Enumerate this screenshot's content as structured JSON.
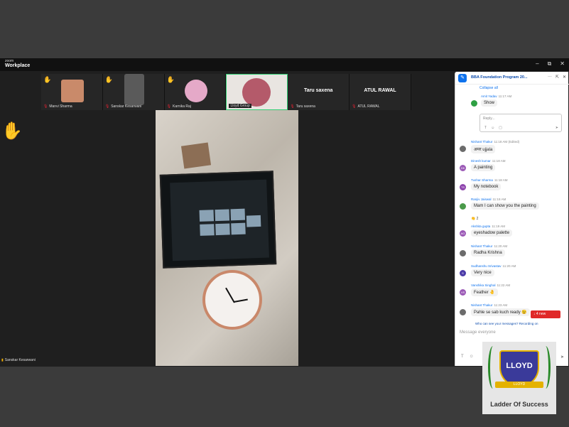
{
  "app": {
    "brand_small": "zoom",
    "brand_title": "Workplace"
  },
  "window_controls": {
    "minimize": "–",
    "restore": "⧉",
    "close": "✕"
  },
  "participants": [
    {
      "name": "Manvi Sharma",
      "hand": true
    },
    {
      "name": "Sanskar Kesarwani",
      "hand": true
    },
    {
      "name": "Karnika Raj",
      "hand": true
    },
    {
      "name": "Lloyd Group",
      "hand": false,
      "active": true
    },
    {
      "name": "Taru saxena",
      "display": "Taru saxena",
      "hand": false
    },
    {
      "name": "ATUL RAWAL",
      "display": "ATUL RAWAL",
      "hand": false
    }
  ],
  "self_view_name": "Sanskar Kesarwani",
  "chat": {
    "title": "BBA Foundation Program 20...",
    "collapse_label": "Collapse all",
    "thread": {
      "author": "Amit Yadav",
      "time": "11:17 AM",
      "text": "Show"
    },
    "reply_placeholder": "Reply...",
    "messages": [
      {
        "author": "Nishant Thakur",
        "time": "11:18 AM (Edited)",
        "text": "अमर ujjala",
        "initials": "",
        "color": "#6b6b6b"
      },
      {
        "author": "Dinesh kumar",
        "time": "11:18 AM",
        "text": "A painting",
        "initials": "DK",
        "color": "#9b59b6"
      },
      {
        "author": "Tushar Sharma",
        "time": "11:18 AM",
        "text": "My notebook",
        "initials": "TS",
        "color": "#8e44ad"
      },
      {
        "author": "Ranjiv Jaiswal",
        "time": "11:18 AM",
        "text": "Mam I can show you the painting",
        "initials": "",
        "color": "#4a9a4a"
      },
      {
        "author": "Akshita gupta",
        "time": "11:19 AM",
        "text": "eyeshadow palette",
        "initials": "AG",
        "color": "#9b59b6"
      },
      {
        "author": "Nishant Thakur",
        "time": "11:20 AM",
        "text": "Radha Krishna",
        "initials": "",
        "color": "#6b6b6b"
      },
      {
        "author": "Sudhanshu Srivastav",
        "time": "11:20 AM",
        "text": "Very nice",
        "initials": "S",
        "color": "#4b3ba8"
      },
      {
        "author": "Vanshika Singhal",
        "time": "11:22 AM",
        "text": "Feather 🤚",
        "initials": "VS",
        "color": "#9b59b6"
      },
      {
        "author": "Nishant Thakur",
        "time": "11:23 AM",
        "text": "Pahle se sab kuch ready 😉",
        "initials": "",
        "color": "#6b6b6b"
      }
    ],
    "reaction_count": "👏 2",
    "new_badge": "↓ 4 new",
    "who_can_see": "Who can see your messages? Recording on",
    "input_placeholder": "Message everyone"
  },
  "logo": {
    "shield_text": "LLOYD",
    "ribbon_text": "LLOYD",
    "tagline": "Ladder Of Success"
  }
}
